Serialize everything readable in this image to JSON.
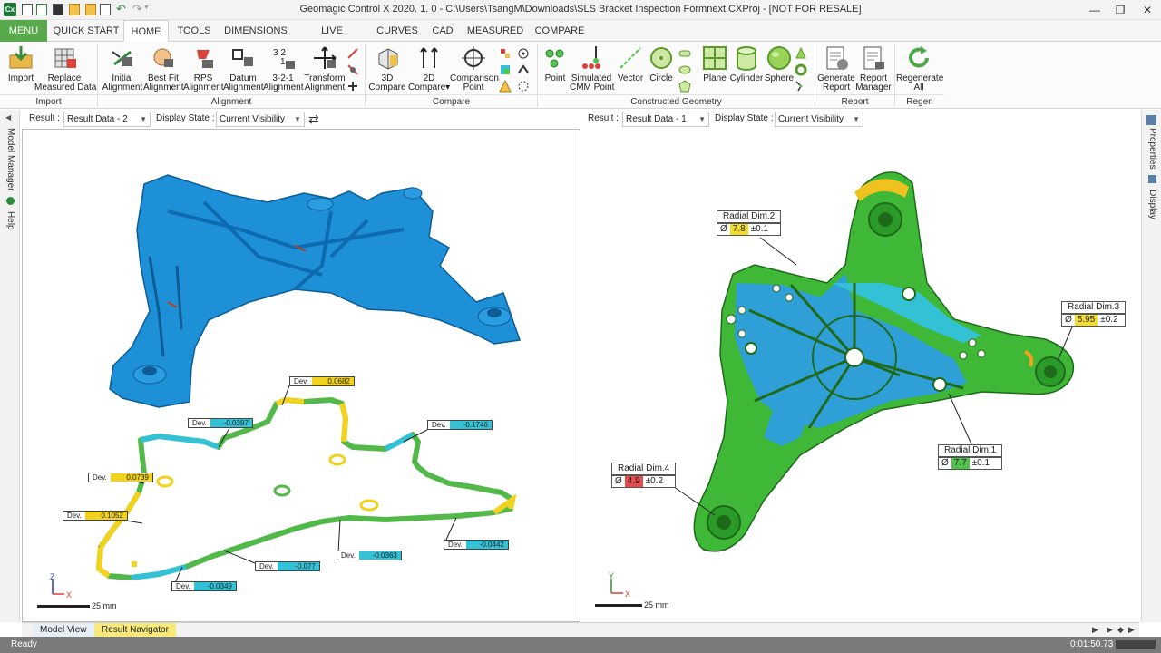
{
  "window": {
    "title": "Geomagic Control X 2020. 1. 0 - C:\\Users\\TsangM\\Downloads\\SLS Bracket Inspection Formnext.CXProj - [NOT FOR RESALE]",
    "app_icon_text": "Cx"
  },
  "tabs": [
    "MENU",
    "QUICK START",
    "HOME",
    "TOOLS",
    "DIMENSIONS",
    "LIVE CAPTURE",
    "CURVES",
    "CAD",
    "MEASURED",
    "COMPARE"
  ],
  "ribbon": {
    "import_label": "Import",
    "replace_line1": "Replace",
    "replace_line2": "Measured Data",
    "initial_line1": "Initial",
    "initial_line2": "Alignment",
    "bestfit_line1": "Best Fit",
    "bestfit_line2": "Alignment",
    "rps_line1": "RPS",
    "rps_line2": "Alignment",
    "datum_line1": "Datum",
    "datum_line2": "Alignment",
    "three21_line1": "3-2-1",
    "three21_line2": "Alignment",
    "three21_icon_text": "3 2\n1",
    "transform_line1": "Transform",
    "transform_line2": "Alignment",
    "compare3d_line1": "3D",
    "compare3d_line2": "Compare",
    "compare2d_line1": "2D",
    "compare2d_line2": "Compare▾",
    "comparison_line1": "Comparison",
    "comparison_line2": "Point",
    "point_label": "Point",
    "simulated_line1": "Simulated",
    "simulated_line2": "CMM Point",
    "vector_label": "Vector",
    "circle_label": "Circle",
    "plane_label": "Plane",
    "cylinder_label": "Cylinder",
    "sphere_label": "Sphere",
    "generate_line1": "Generate",
    "generate_line2": "Report",
    "manager_line1": "Report",
    "manager_line2": "Manager",
    "regen_line1": "Regenerate",
    "regen_line2": "All",
    "groups": {
      "import": "Import",
      "alignment": "Alignment",
      "compare": "Compare",
      "constructed": "Constructed Geometry",
      "report": "Report",
      "regen": "Regen"
    }
  },
  "left_panel": {
    "model_manager": "Model Manager",
    "help": "Help"
  },
  "right_panel": {
    "properties": "Properties",
    "display": "Display"
  },
  "view_left": {
    "result_label": "Result :",
    "result_value": "Result Data - 2",
    "display_label": "Display State :",
    "display_value": "Current Visibility",
    "scale_text": "25 mm",
    "axis_z": "Z",
    "axis_x": "X",
    "dev_key": "Dev.",
    "devs": [
      "0.0682",
      "-0.0397",
      "-0.1746",
      "0.0739",
      "0.1052",
      "-0.077",
      "-0.0363",
      "-0.0442",
      "-0.0349"
    ]
  },
  "view_right": {
    "result_label": "Result :",
    "result_value": "Result Data - 1",
    "display_label": "Display State :",
    "display_value": "Current Visibility",
    "scale_text": "25 mm",
    "axis_y": "Y",
    "axis_x": "X",
    "phi": "Ø",
    "dims": [
      {
        "title": "Radial Dim.2",
        "value": "7.8",
        "tol": "±0.1",
        "color": "#f4dc2a"
      },
      {
        "title": "Radial Dim.3",
        "value": "5.95",
        "tol": "±0.2",
        "color": "#f4dc2a"
      },
      {
        "title": "Radial Dim.1",
        "value": "7.7",
        "tol": "±0.1",
        "color": "#4fc34a"
      },
      {
        "title": "Radial Dim.4",
        "value": "4.9",
        "tol": "±0.2",
        "color": "#e84a4a"
      }
    ]
  },
  "view_tabs": {
    "model_view": "Model View",
    "result_navigator": "Result Navigator"
  },
  "status": {
    "text": "Ready",
    "time": "0:01:50.73"
  },
  "colors": {
    "accent": "#58a84c",
    "mesh_blue": "#1e90d8",
    "dev_green": "#52b84a",
    "dev_yellow": "#f0d21f",
    "dev_cyan": "#33c1d6"
  }
}
